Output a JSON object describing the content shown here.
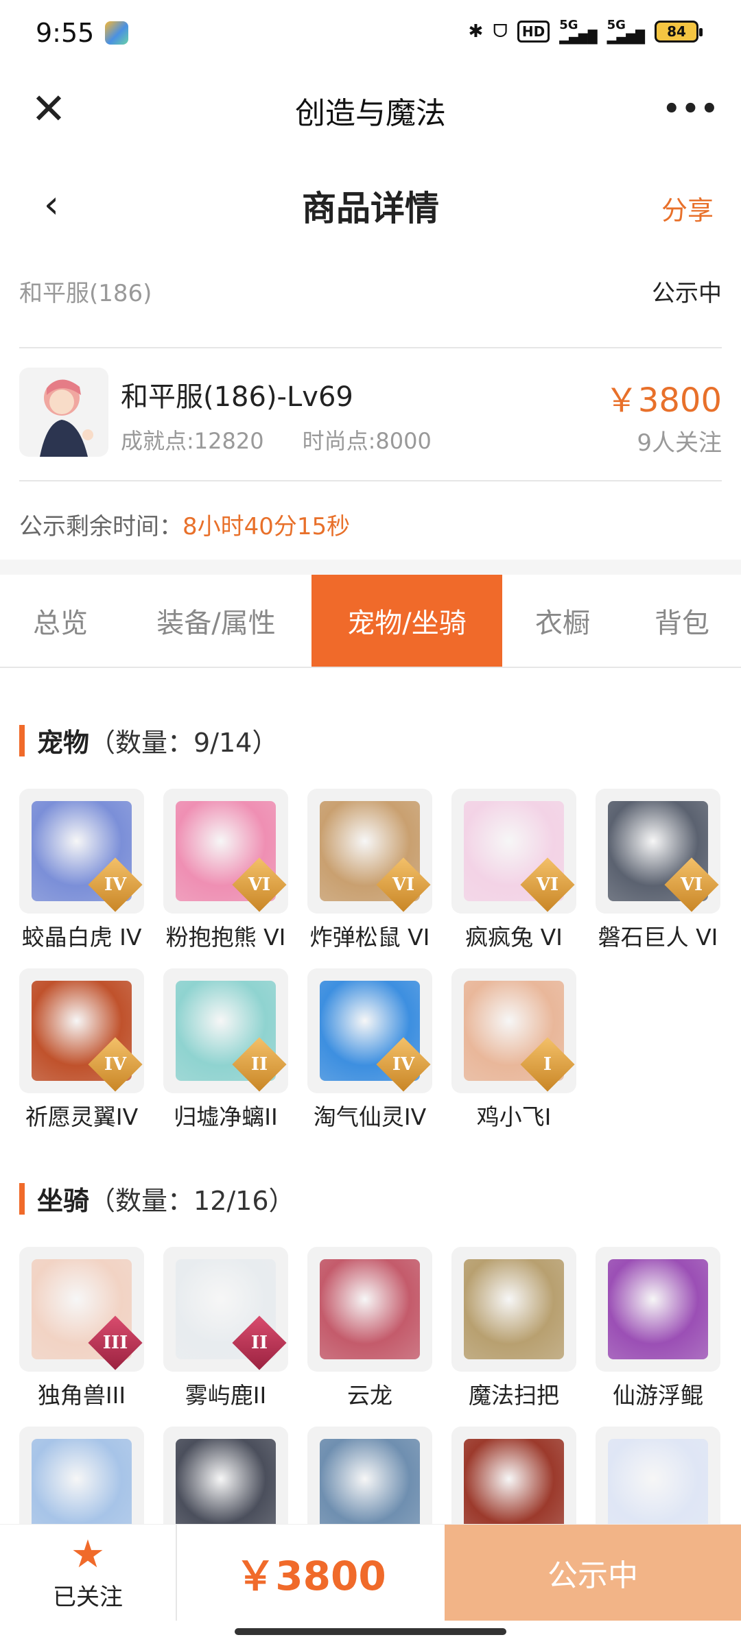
{
  "status_bar": {
    "time": "9:55",
    "bluetooth_icon": "✱",
    "earbuds_icon": "ᗜ",
    "hd": "HD",
    "signal_1": "5G",
    "signal_2": "5G",
    "battery": "84"
  },
  "app_bar": {
    "title": "创造与魔法",
    "close_glyph": "✕",
    "more_glyph": "•••"
  },
  "page_header": {
    "title": "商品详情",
    "share": "分享",
    "back_glyph": "‹"
  },
  "account": {
    "server": "和平服(186)",
    "status": "公示中",
    "name": "和平服(186)-Lv69",
    "achievement": "成就点:12820",
    "fashion": "时尚点:8000",
    "price": "￥3800",
    "followers": "9人关注",
    "remain_label": "公示剩余时间：",
    "remain_time": "8小时40分15秒"
  },
  "tabs": [
    {
      "label": "总览",
      "active": false
    },
    {
      "label": "装备/属性",
      "active": false
    },
    {
      "label": "宠物/坐骑",
      "active": true
    },
    {
      "label": "衣橱",
      "active": false
    },
    {
      "label": "背包",
      "active": false
    }
  ],
  "pets": {
    "title": "宠物",
    "count": "（数量：9/14）",
    "items": [
      {
        "name": "蛟晶白虎 IV",
        "badge": "IV",
        "color": "#7b8fd8"
      },
      {
        "name": "粉抱抱熊 VI",
        "badge": "VI",
        "color": "#ef8fb3"
      },
      {
        "name": "炸弹松鼠 VI",
        "badge": "VI",
        "color": "#c9a070"
      },
      {
        "name": "疯疯兔 VI",
        "badge": "VI",
        "color": "#f3d3e6"
      },
      {
        "name": "磐石巨人 VI",
        "badge": "VI",
        "color": "#5b6270"
      },
      {
        "name": "祈愿灵翼IV",
        "badge": "IV",
        "color": "#c0522c"
      },
      {
        "name": "归墟净螭II",
        "badge": "II",
        "color": "#8fd3d0"
      },
      {
        "name": "淘气仙灵IV",
        "badge": "IV",
        "color": "#3d8fe0"
      },
      {
        "name": "鸡小飞I",
        "badge": "I",
        "color": "#e9b79a"
      }
    ]
  },
  "mounts": {
    "title": "坐骑",
    "count": "（数量：12/16）",
    "items": [
      {
        "name": "独角兽III",
        "badge": "III",
        "color": "#f2d3c4"
      },
      {
        "name": "雾屿鹿II",
        "badge": "II",
        "color": "#e8ecef"
      },
      {
        "name": "云龙",
        "badge": "",
        "color": "#c45b6b"
      },
      {
        "name": "魔法扫把",
        "badge": "",
        "color": "#b8a070"
      },
      {
        "name": "仙游浮鲲",
        "badge": "",
        "color": "#9b4fb5"
      },
      {
        "name": "",
        "badge": "",
        "color": "#a7c4e8"
      },
      {
        "name": "",
        "badge": "",
        "color": "#4b4f5c"
      },
      {
        "name": "",
        "badge": "",
        "color": "#6f8fb0"
      },
      {
        "name": "",
        "badge": "",
        "color": "#9c3a2c"
      },
      {
        "name": "",
        "badge": "",
        "color": "#dfe6f5"
      }
    ]
  },
  "bottom_bar": {
    "star_glyph": "★",
    "follow_label": "已关注",
    "price": "￥3800",
    "action": "公示中"
  }
}
